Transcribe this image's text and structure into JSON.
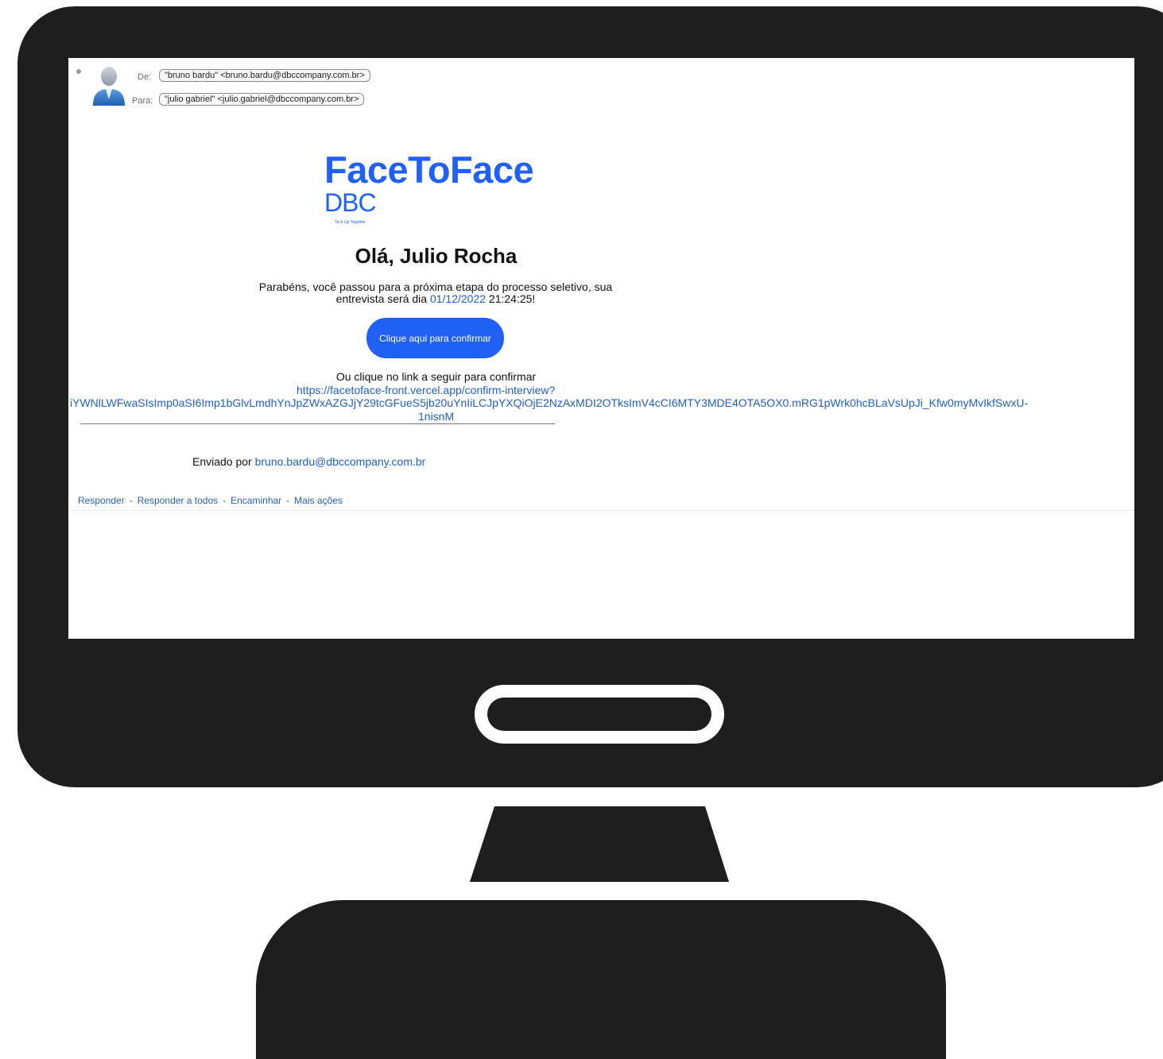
{
  "email": {
    "from_label": "De:",
    "from_value": "\"bruno bardu\" <bruno.bardu@dbccompany.com.br>",
    "to_label": "Para:",
    "to_value": "\"julio gabriel\" <julio.gabriel@dbccompany.com.br>"
  },
  "logo": {
    "main": "FaceToFace",
    "sub": "DBC",
    "tagline": "Tech Up Together"
  },
  "content": {
    "greeting": "Olá, Julio Rocha",
    "message_part1": "Parabéns, você passou para a próxima etapa do processo seletivo, sua entrevista será dia ",
    "message_date": "01/12/2022",
    "message_part2": " 21:24:25!",
    "button_label": "Clique aqui para confirmar",
    "alt_text": "Ou clique no link a seguir para confirmar",
    "link_line1": "https://facetoface-front.vercel.app/confirm-interview?",
    "link_line2": "iYWNlLWFwaSIsImp0aSI6Imp1bGlvLmdhYnJpZWxAZGJjY29tcGFueS5jb20uYnIiLCJpYXQiOjE2NzAxMDI2OTksImV4cCI6MTY3MDE4OTA5OX0.mRG1pWrk0hcBLaVsUpJi_Kfw0myMvIkfSwxU-",
    "link_line3": "1nisnM",
    "sent_by_label": "Enviado por ",
    "sent_by_email": "bruno.bardu@dbccompany.com.br"
  },
  "actions": {
    "reply": "Responder",
    "reply_all": "Responder a todos",
    "forward": "Encaminhar",
    "more": "Mais ações",
    "separator": "-"
  },
  "colors": {
    "brand_blue": "#2160f5",
    "link_blue": "#2160c8",
    "monitor": "#1e1e1e"
  }
}
